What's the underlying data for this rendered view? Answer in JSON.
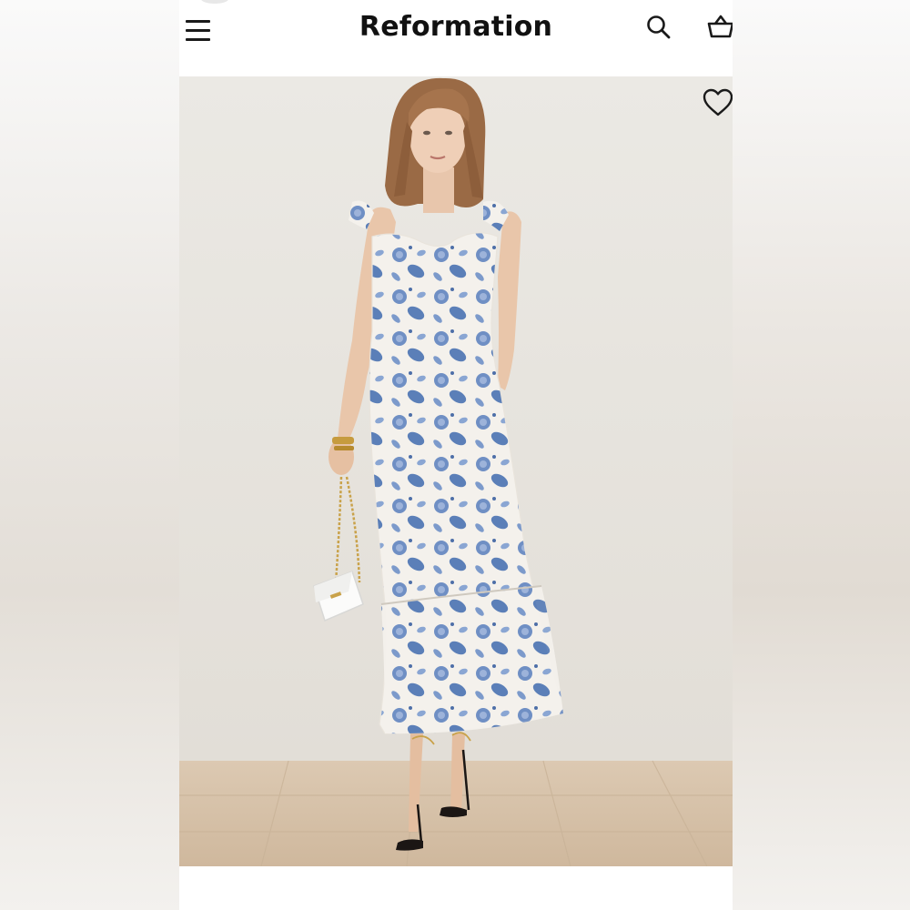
{
  "header": {
    "brand": "Reformation",
    "menu_icon": "hamburger-menu-icon",
    "search_icon": "search-icon",
    "bag_icon": "shopping-bag-icon"
  },
  "product_image": {
    "wishlist_icon": "heart-outline-icon"
  },
  "colors": {
    "background": "#ffffff",
    "brand_text": "#111111",
    "photo_wall": "#e7e4df",
    "floor": "#d8c5ae",
    "dress_base": "#f4f1ec",
    "dress_print": "#5b7fb8"
  }
}
